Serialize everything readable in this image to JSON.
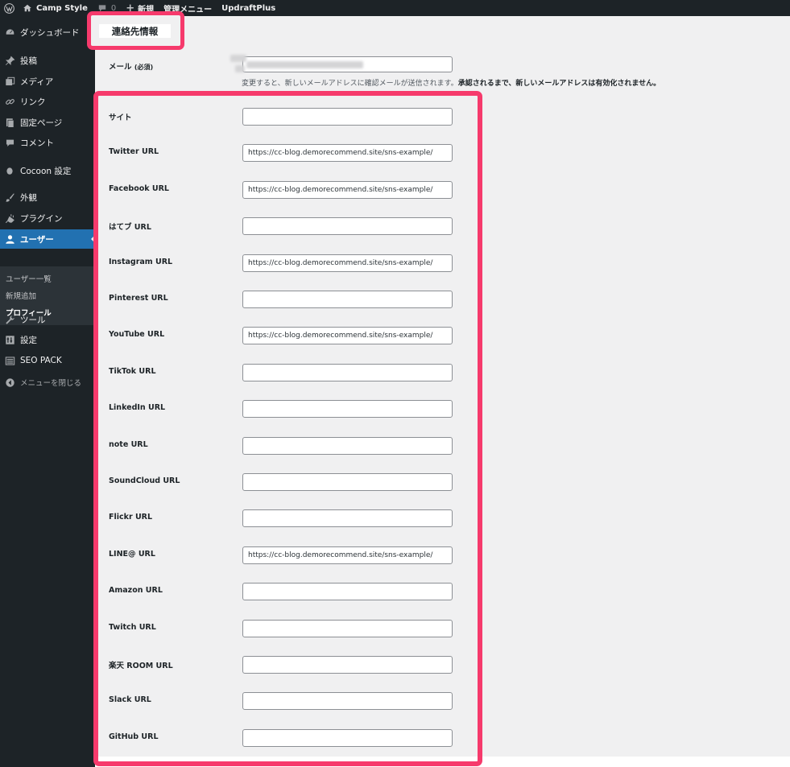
{
  "admin_bar": {
    "site_name": "Camp Style",
    "comments_count": "0",
    "new_label": "新規",
    "admin_menu_label": "管理メニュー",
    "updraft_label": "UpdraftPlus"
  },
  "sidebar": {
    "items": [
      {
        "label": "ダッシュボード",
        "icon": "dashboard-icon"
      },
      {
        "label": "投稿",
        "icon": "pin-icon"
      },
      {
        "label": "メディア",
        "icon": "media-icon"
      },
      {
        "label": "リンク",
        "icon": "link-icon"
      },
      {
        "label": "固定ページ",
        "icon": "page-icon"
      },
      {
        "label": "コメント",
        "icon": "comment-icon"
      },
      {
        "label": "Cocoon 設定",
        "icon": "cocoon-icon"
      },
      {
        "label": "外観",
        "icon": "brush-icon"
      },
      {
        "label": "プラグイン",
        "icon": "plugin-icon"
      },
      {
        "label": "ユーザー",
        "icon": "user-icon"
      },
      {
        "label": "ツール",
        "icon": "wrench-icon"
      },
      {
        "label": "設定",
        "icon": "settings-icon"
      },
      {
        "label": "SEO PACK",
        "icon": "list-icon"
      },
      {
        "label": "メニューを閉じる",
        "icon": "collapse-icon"
      }
    ],
    "submenu": [
      {
        "label": "ユーザー一覧"
      },
      {
        "label": "新規追加"
      },
      {
        "label": "プロフィール"
      }
    ]
  },
  "section": {
    "title": "連絡先情報"
  },
  "email": {
    "label": "メール",
    "required": "(必須)",
    "description_normal": "変更すると、新しいメールアドレスに確認メールが送信されます。",
    "description_bold": "承認されるまで、新しいメールアドレスは有効化されません。"
  },
  "fields": [
    {
      "label": "サイト",
      "value": ""
    },
    {
      "label": "Twitter URL",
      "value": "https://cc-blog.demorecommend.site/sns-example/"
    },
    {
      "label": "Facebook URL",
      "value": "https://cc-blog.demorecommend.site/sns-example/"
    },
    {
      "label": "はてブ URL",
      "value": ""
    },
    {
      "label": "Instagram URL",
      "value": "https://cc-blog.demorecommend.site/sns-example/"
    },
    {
      "label": "Pinterest URL",
      "value": ""
    },
    {
      "label": "YouTube URL",
      "value": "https://cc-blog.demorecommend.site/sns-example/"
    },
    {
      "label": "TikTok URL",
      "value": ""
    },
    {
      "label": "LinkedIn URL",
      "value": ""
    },
    {
      "label": "note URL",
      "value": ""
    },
    {
      "label": "SoundCloud URL",
      "value": ""
    },
    {
      "label": "Flickr URL",
      "value": ""
    },
    {
      "label": "LINE@ URL",
      "value": "https://cc-blog.demorecommend.site/sns-example/"
    },
    {
      "label": "Amazon URL",
      "value": ""
    },
    {
      "label": "Twitch URL",
      "value": ""
    },
    {
      "label": "楽天 ROOM URL",
      "value": ""
    },
    {
      "label": "Slack URL",
      "value": ""
    },
    {
      "label": "GitHub URL",
      "value": ""
    }
  ],
  "colors": {
    "admin_dark": "#1d2327",
    "admin_blue": "#2271b1",
    "highlight": "#f63a6c",
    "content_bg": "#f0f0f1"
  }
}
